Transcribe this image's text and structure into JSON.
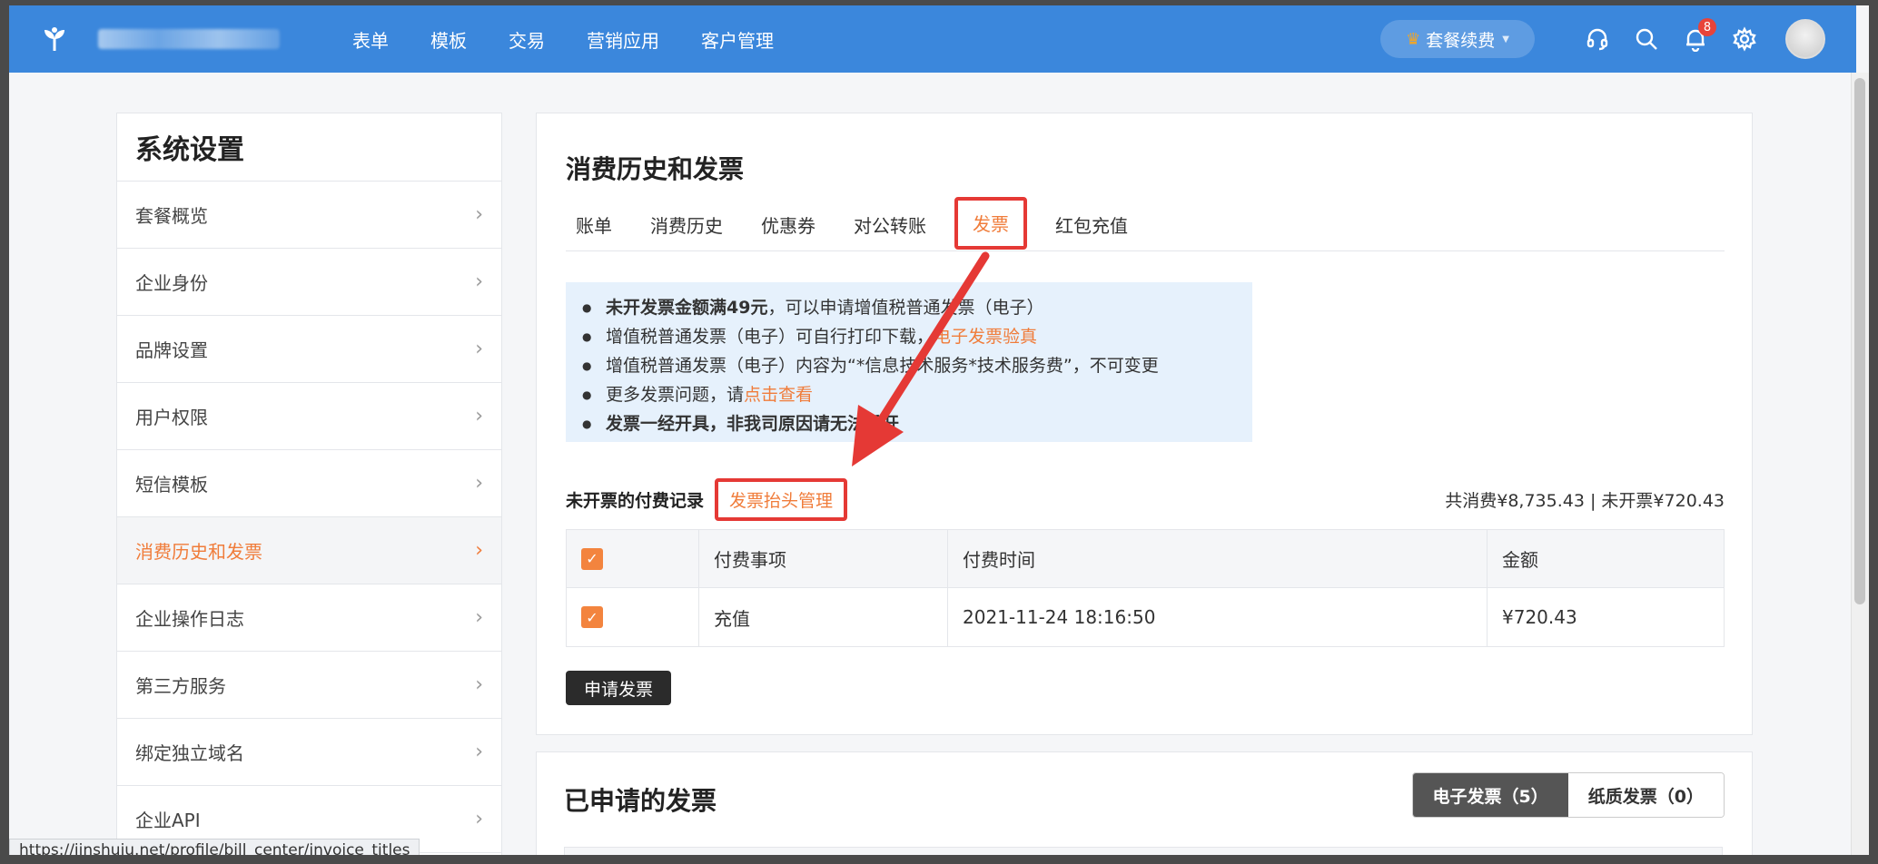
{
  "topbar": {
    "nav": [
      "表单",
      "模板",
      "交易",
      "营销应用",
      "客户管理"
    ],
    "plan_label": "套餐续费",
    "notification_count": "8"
  },
  "sidebar": {
    "title": "系统设置",
    "items": [
      {
        "label": "套餐概览"
      },
      {
        "label": "企业身份"
      },
      {
        "label": "品牌设置"
      },
      {
        "label": "用户权限"
      },
      {
        "label": "短信模板"
      },
      {
        "label": "消费历史和发票",
        "active": true
      },
      {
        "label": "企业操作日志"
      },
      {
        "label": "第三方服务"
      },
      {
        "label": "绑定独立域名"
      },
      {
        "label": "企业API"
      }
    ]
  },
  "main": {
    "title": "消费历史和发票",
    "tabs": [
      "账单",
      "消费历史",
      "优惠券",
      "对公转账",
      "发票",
      "红包充值"
    ],
    "active_tab": "发票",
    "notice": {
      "line1_bold": "未开发票金额满49元",
      "line1_rest": "，可以申请增值税普通发票（电子）",
      "line2_text": "增值税普通发票（电子）可自行打印下载，",
      "line2_link": "电子发票验真",
      "line3": "增值税普通发票（电子）内容为“*信息技术服务*技术服务费”，不可变更",
      "line4_text": "更多发票问题，请",
      "line4_link": "点击查看",
      "line5_bold": "发票一经开具，非我司原因请无法重开"
    },
    "records_label": "未开票的付费记录",
    "title_mgmt_link": "发票抬头管理",
    "totals": "共消费¥8,735.43 | 未开票¥720.43",
    "table": {
      "headers": [
        "付费事项",
        "付费时间",
        "金额"
      ],
      "rows": [
        {
          "item": "充值",
          "time": "2021-11-24 18:16:50",
          "amount": "¥720.43"
        }
      ]
    },
    "apply_button": "申请发票"
  },
  "applied": {
    "title": "已申请的发票",
    "electronic": "电子发票（5）",
    "paper": "纸质发票（0）"
  },
  "statusbar_url": "https://jinshuju.net/profile/bill_center/invoice_titles",
  "colors": {
    "topbar": "#3b87dc",
    "accent": "#f07c3a",
    "annotation_red": "#e53935"
  }
}
